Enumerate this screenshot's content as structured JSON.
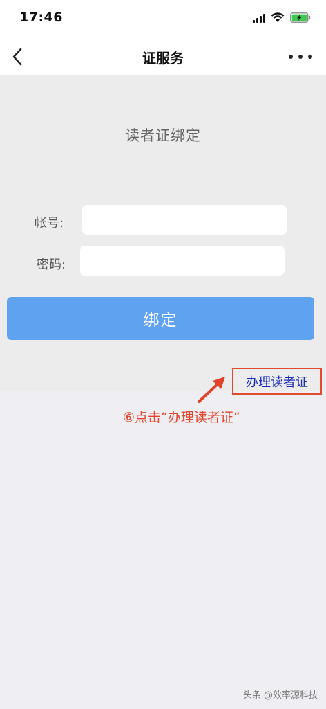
{
  "status_bar": {
    "time": "17:46"
  },
  "nav": {
    "title": "证服务"
  },
  "panel": {
    "title": "读者证绑定",
    "account_label": "帐号:",
    "password_label": "密码:",
    "account_value": "",
    "password_value": "",
    "bind_label": "绑定"
  },
  "apply_link": {
    "label": "办理读者证"
  },
  "annotation": {
    "text": "⑥点击“办理读者证”"
  },
  "watermark": {
    "text": "头条 @效率源科技"
  },
  "colors": {
    "accent_button": "#5fa2f0",
    "annotation_red": "#e0452c",
    "link_blue": "#1c2fb8"
  },
  "icons": {
    "back": "back-chevron-icon",
    "more": "more-dots-icon",
    "signal": "signal-icon",
    "wifi": "wifi-icon",
    "battery": "battery-charging-icon",
    "arrow": "annotation-arrow-icon"
  }
}
